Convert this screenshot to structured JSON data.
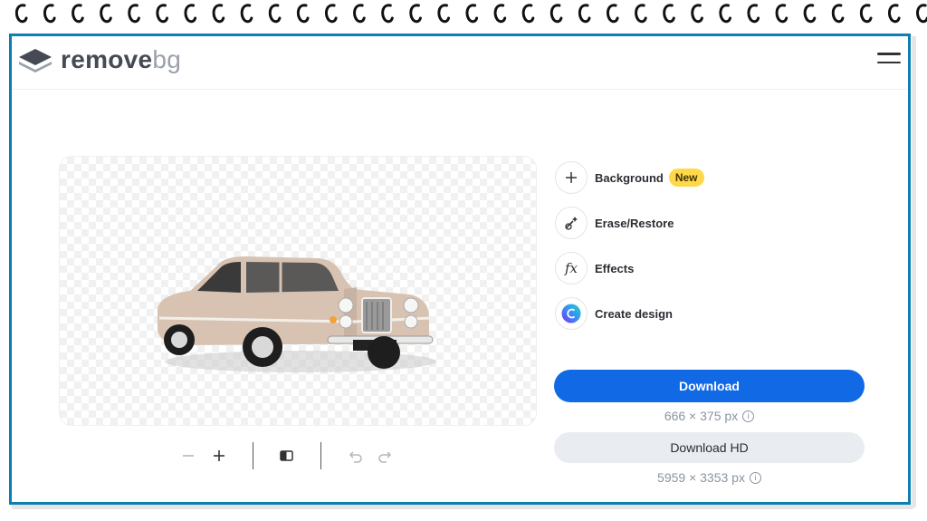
{
  "brand": {
    "name_main": "remove",
    "name_suffix": "bg"
  },
  "header": {
    "menu_icon": "hamburger-icon"
  },
  "editor": {
    "image_alt": "car",
    "toolbar": [
      "minus-icon",
      "plus-icon",
      "compare-icon",
      "undo-icon",
      "redo-icon"
    ]
  },
  "tools": [
    {
      "label": "Background",
      "icon": "plus-icon",
      "badge": "New"
    },
    {
      "label": "Erase/Restore",
      "icon": "magic-brush-icon"
    },
    {
      "label": "Effects",
      "icon": "fx-icon"
    },
    {
      "label": "Create design",
      "icon": "canva-icon"
    }
  ],
  "download": {
    "label": "Download",
    "resolution": "666 × 375 px"
  },
  "download_hd": {
    "label": "Download HD",
    "resolution": "5959 × 3353 px"
  },
  "colors": {
    "accent": "#1169e6",
    "frame": "#0d7fb0",
    "badge": "#ffd84a"
  }
}
